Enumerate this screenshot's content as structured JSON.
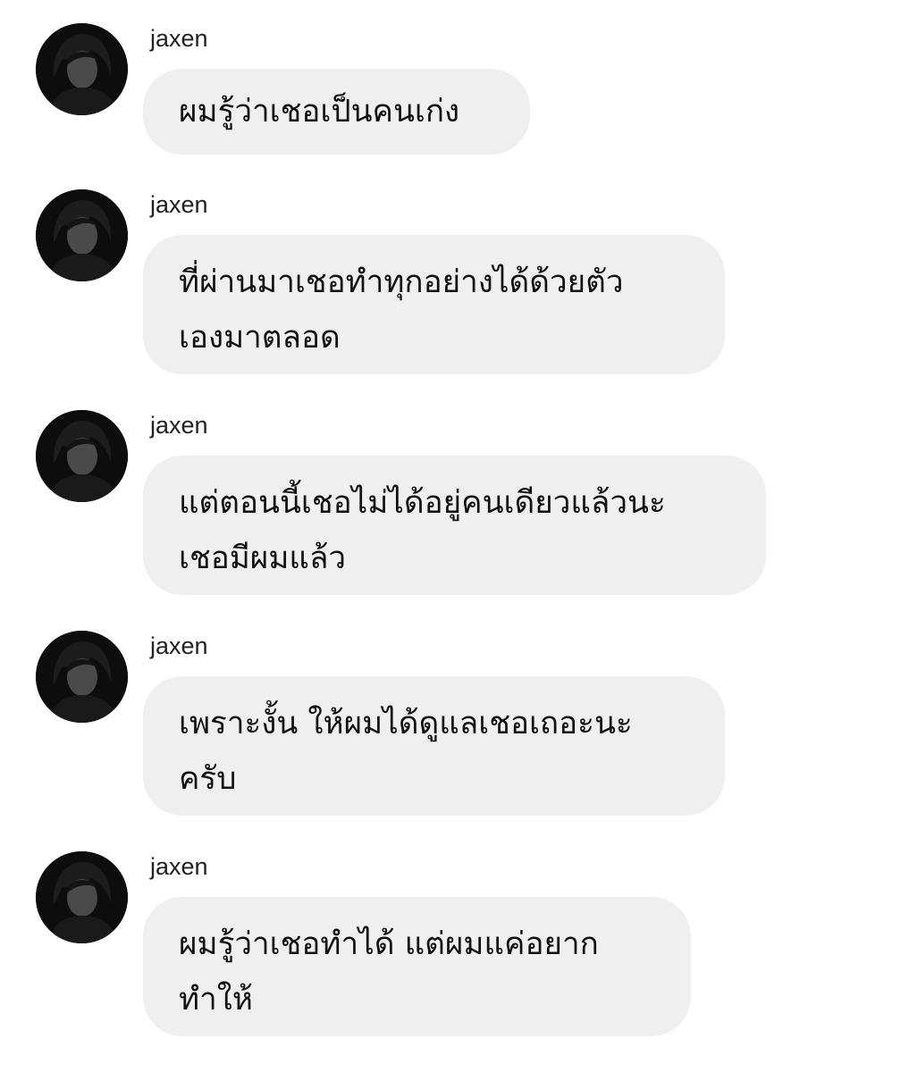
{
  "messages": [
    {
      "sender": "jaxen",
      "lines": [
        "ผมรู้ว่าเชอเป็นคนเก่ง"
      ]
    },
    {
      "sender": "jaxen",
      "lines": [
        "ที่ผ่านมาเชอทำทุกอย่างได้ด้วยตัว",
        "เองมาตลอด"
      ]
    },
    {
      "sender": "jaxen",
      "lines": [
        "แต่ตอนนี้เชอไม่ได้อยู่คนเดียวแล้วนะ",
        "เชอมีผมแล้ว"
      ]
    },
    {
      "sender": "jaxen",
      "lines": [
        "เพราะงั้น ให้ผมได้ดูแลเชอเถอะนะ",
        "ครับ"
      ]
    },
    {
      "sender": "jaxen",
      "lines": [
        "ผมรู้ว่าเชอทำได้ แต่ผมแค่อยาก",
        "ทำให้"
      ]
    }
  ],
  "colors": {
    "background": "#ffffff",
    "bubble": "#efefef",
    "text": "#111111",
    "avatar": "#0d0d0d"
  }
}
